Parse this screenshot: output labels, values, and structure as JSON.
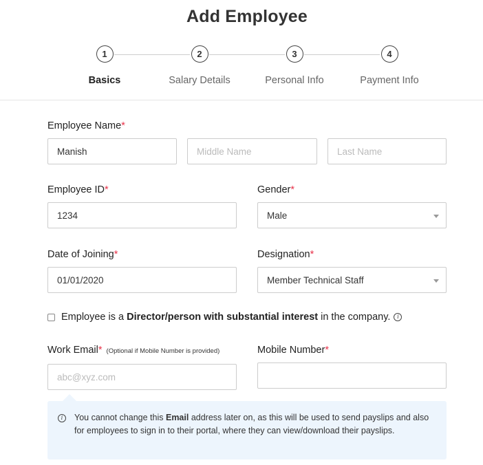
{
  "page": {
    "title": "Add Employee"
  },
  "stepper": {
    "steps": [
      {
        "number": "1",
        "label": "Basics",
        "active": true
      },
      {
        "number": "2",
        "label": "Salary Details",
        "active": false
      },
      {
        "number": "3",
        "label": "Personal Info",
        "active": false
      },
      {
        "number": "4",
        "label": "Payment Info",
        "active": false
      }
    ]
  },
  "form": {
    "employee_name": {
      "label": "Employee Name",
      "required_mark": "*",
      "first_value": "Manish",
      "middle_placeholder": "Middle Name",
      "last_placeholder": "Last Name"
    },
    "employee_id": {
      "label": "Employee ID",
      "required_mark": "*",
      "value": "1234"
    },
    "gender": {
      "label": "Gender",
      "required_mark": "*",
      "selected": "Male"
    },
    "date_of_joining": {
      "label": "Date of Joining",
      "required_mark": "*",
      "value": "01/01/2020"
    },
    "designation": {
      "label": "Designation",
      "required_mark": "*",
      "selected": "Member Technical Staff"
    },
    "director_checkbox": {
      "checked": false,
      "text_before": "Employee is a ",
      "text_bold": "Director/person with substantial interest",
      "text_after": " in the company.",
      "info_icon": "info-icon"
    },
    "work_email": {
      "label": "Work Email",
      "required_mark": "*",
      "hint": "(Optional if Mobile Number is provided)",
      "placeholder": "abc@xyz.com",
      "value": ""
    },
    "mobile_number": {
      "label": "Mobile Number",
      "required_mark": "*",
      "value": ""
    }
  },
  "email_notice": {
    "icon": "info-icon",
    "text_before": "You cannot change this ",
    "text_bold": "Email",
    "text_after": " address later on, as this will be used to send payslips and also for employees to sign in to their portal, where they can view/download their payslips."
  }
}
